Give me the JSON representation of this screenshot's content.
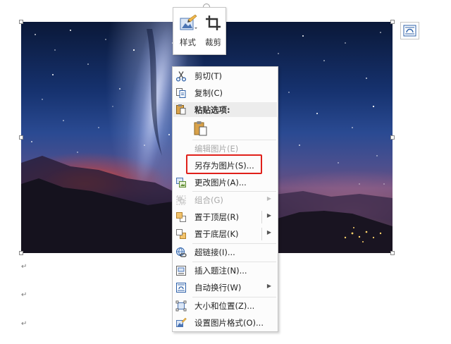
{
  "mini_toolbar": {
    "style_label": "样式",
    "crop_label": "裁剪"
  },
  "context_menu": {
    "items": [
      {
        "label": "剪切(T)",
        "icon": "scissors-icon",
        "enabled": true
      },
      {
        "label": "复制(C)",
        "icon": "copy-icon",
        "enabled": true
      },
      {
        "label": "粘贴选项:",
        "icon": "paste-icon",
        "enabled": true
      },
      {
        "label": "编辑图片(E)",
        "icon": "",
        "enabled": false
      },
      {
        "label": "另存为图片(S)...",
        "icon": "",
        "enabled": true
      },
      {
        "label": "更改图片(A)...",
        "icon": "change-picture-icon",
        "enabled": true
      },
      {
        "label": "组合(G)",
        "icon": "group-icon",
        "enabled": false
      },
      {
        "label": "置于顶层(R)",
        "icon": "bring-to-front-icon",
        "enabled": true
      },
      {
        "label": "置于底层(K)",
        "icon": "send-to-back-icon",
        "enabled": true
      },
      {
        "label": "超链接(I)...",
        "icon": "hyperlink-icon",
        "enabled": true
      },
      {
        "label": "插入题注(N)...",
        "icon": "insert-caption-icon",
        "enabled": true
      },
      {
        "label": "自动换行(W)",
        "icon": "wrap-text-icon",
        "enabled": true
      },
      {
        "label": "大小和位置(Z)...",
        "icon": "size-position-icon",
        "enabled": true
      },
      {
        "label": "设置图片格式(O)...",
        "icon": "format-picture-icon",
        "enabled": true
      }
    ]
  },
  "paragraph_mark": "↵",
  "colors": {
    "highlight": "#e0201a",
    "menu_bg": "#fcfcfc",
    "disabled_text": "#a8a8a8"
  }
}
